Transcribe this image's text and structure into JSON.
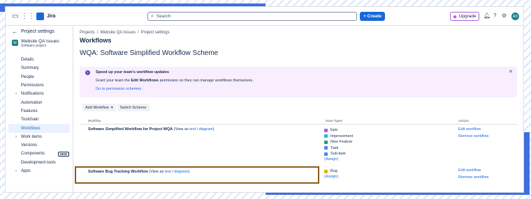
{
  "topbar": {
    "app_name": "Jira",
    "search_placeholder": "Search",
    "create_label": "+ Create",
    "upgrade_label": "Upgrade",
    "avatar_initials": "AD"
  },
  "sidebar": {
    "back_label": "Project settings",
    "project_name": "Website QA Issues",
    "project_type": "Software project",
    "items": [
      {
        "label": "Details"
      },
      {
        "label": "Summary"
      },
      {
        "label": "People"
      },
      {
        "label": "Permissions"
      },
      {
        "label": "Notifications"
      },
      {
        "label": "Automation"
      },
      {
        "label": "Features"
      },
      {
        "label": "Toolchain"
      },
      {
        "label": "Workflows"
      },
      {
        "label": "Work items"
      },
      {
        "label": "Versions"
      },
      {
        "label": "Components",
        "badge": "NEW"
      },
      {
        "label": "Development tools"
      },
      {
        "label": "Apps"
      }
    ]
  },
  "breadcrumb": {
    "projects": "Projects",
    "sep": "/",
    "project": "Website QA Issues",
    "settings": "Project settings"
  },
  "page": {
    "section": "Workflows",
    "title": "WQA: Software Simplified Workflow Scheme"
  },
  "banner": {
    "title": "Speed up your team's workflow updates",
    "body_pre": "Grant your team the ",
    "body_bold": "Edit Workflows",
    "body_post": " permission so they can manage workflows themselves.",
    "link": "Go to permission schemes"
  },
  "buttons": {
    "add_workflow": "Add Workflow",
    "switch_scheme": "Switch Scheme"
  },
  "table": {
    "headers": {
      "workflow": "Workflow",
      "issue_types": "Issue Types",
      "actions": "Actions"
    },
    "rows": [
      {
        "name": "Software Simplified Workflow for Project WQA",
        "view_as": "(View as ",
        "text_link": "text",
        "slash": " / ",
        "diagram_link": "diagram",
        "close": ")",
        "issue_types": [
          "Epic",
          "Improvement",
          "New Feature",
          "Task",
          "Sub-task"
        ],
        "assign": "(Assign)",
        "edit": "Edit workflow",
        "remove": "Remove workflow"
      },
      {
        "name": "Software Bug Tracking Workflow",
        "view_as": "(View as ",
        "text_link": "text",
        "slash": " / ",
        "diagram_link": "diagram",
        "close": ")",
        "issue_types": [
          "Bug"
        ],
        "assign": "(Assign)",
        "edit": "Edit workflow",
        "remove": "Remove workflow"
      }
    ]
  },
  "colors": {
    "accent": "#1868db",
    "banner_bg": "#f8eefe",
    "highlight_border": "#8b5a1c"
  }
}
